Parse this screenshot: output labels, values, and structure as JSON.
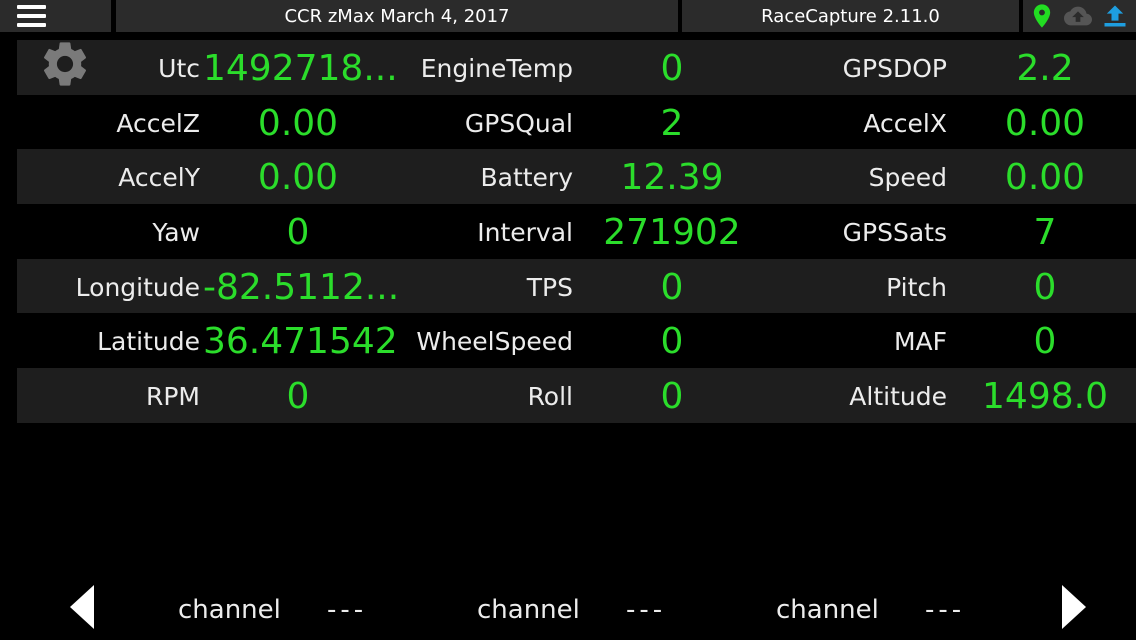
{
  "topbar": {
    "title": "CCR zMax March 4, 2017",
    "app_version": "RaceCapture 2.11.0",
    "icons": [
      "menu-icon",
      "gps-pin-icon",
      "cloud-icon",
      "upload-icon"
    ],
    "colors": {
      "gps": "#22dd22",
      "cloud": "#555555",
      "upload": "#1e9ee0"
    }
  },
  "grid": {
    "rows": [
      {
        "cells": [
          {
            "label": "Utc",
            "value": "1492718..."
          },
          {
            "label": "EngineTemp",
            "value": "0"
          },
          {
            "label": "GPSDOP",
            "value": "2.2"
          }
        ]
      },
      {
        "cells": [
          {
            "label": "AccelZ",
            "value": "0.00"
          },
          {
            "label": "GPSQual",
            "value": "2"
          },
          {
            "label": "AccelX",
            "value": "0.00"
          }
        ]
      },
      {
        "cells": [
          {
            "label": "AccelY",
            "value": "0.00"
          },
          {
            "label": "Battery",
            "value": "12.39"
          },
          {
            "label": "Speed",
            "value": "0.00"
          }
        ]
      },
      {
        "cells": [
          {
            "label": "Yaw",
            "value": "0"
          },
          {
            "label": "Interval",
            "value": "271902"
          },
          {
            "label": "GPSSats",
            "value": "7"
          }
        ]
      },
      {
        "cells": [
          {
            "label": "Longitude",
            "value": "-82.5112..."
          },
          {
            "label": "TPS",
            "value": "0"
          },
          {
            "label": "Pitch",
            "value": "0"
          }
        ]
      },
      {
        "cells": [
          {
            "label": "Latitude",
            "value": "36.471542"
          },
          {
            "label": "WheelSpeed",
            "value": "0"
          },
          {
            "label": "MAF",
            "value": "0"
          }
        ]
      },
      {
        "cells": [
          {
            "label": "RPM",
            "value": "0"
          },
          {
            "label": "Roll",
            "value": "0"
          },
          {
            "label": "Altitude",
            "value": "1498.0"
          }
        ]
      }
    ],
    "value_color": "#2bdd2b"
  },
  "bottombar": {
    "channels": [
      {
        "name": "channel",
        "value": "---"
      },
      {
        "name": "channel",
        "value": "---"
      },
      {
        "name": "channel",
        "value": "---"
      }
    ]
  }
}
